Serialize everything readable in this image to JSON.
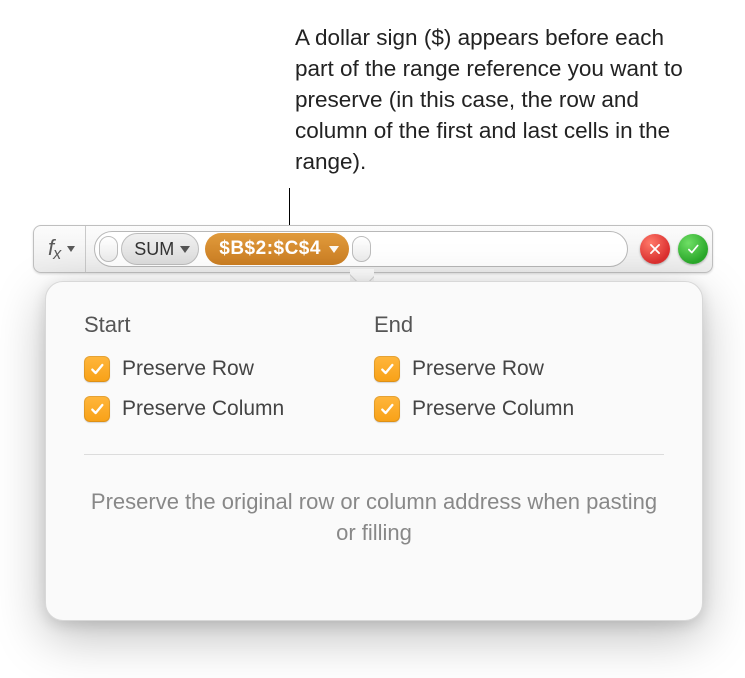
{
  "callout": "A dollar sign ($) appears before each part of the range reference you want to preserve (in this case, the row and column of the first and last cells in the range).",
  "formula_bar": {
    "fx_label": "fx",
    "function_name": "SUM",
    "range_reference": "$B$2:$C$4"
  },
  "popover": {
    "start": {
      "title": "Start",
      "preserve_row": {
        "label": "Preserve Row",
        "checked": true
      },
      "preserve_column": {
        "label": "Preserve Column",
        "checked": true
      }
    },
    "end": {
      "title": "End",
      "preserve_row": {
        "label": "Preserve Row",
        "checked": true
      },
      "preserve_column": {
        "label": "Preserve Column",
        "checked": true
      }
    },
    "hint": "Preserve the original row or column address when pasting or filling"
  }
}
